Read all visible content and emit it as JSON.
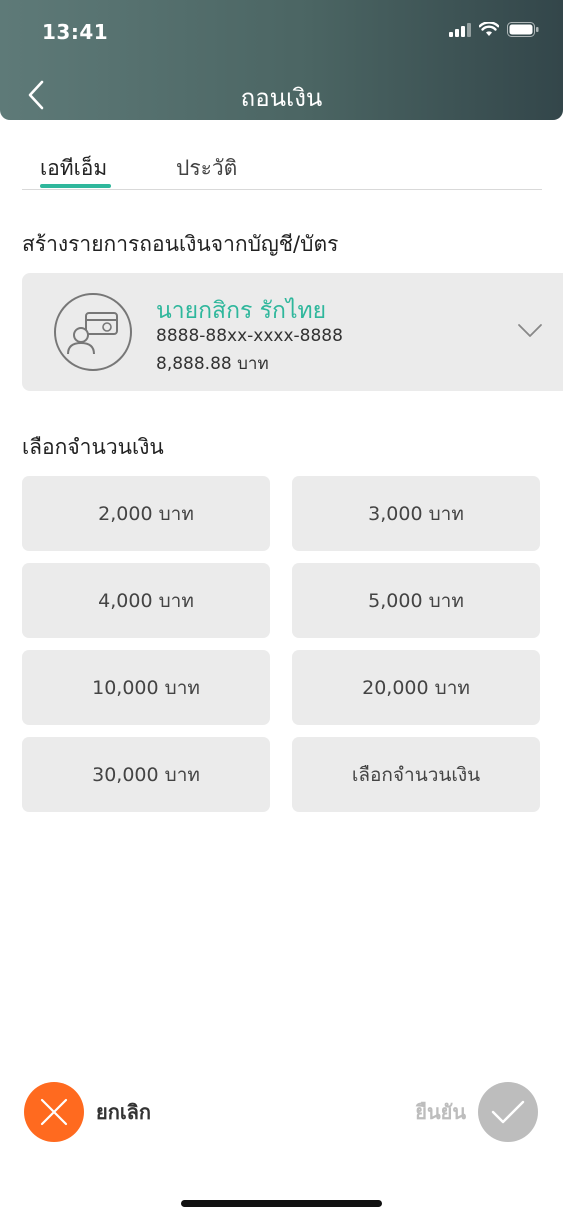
{
  "status_bar": {
    "time": "13:41"
  },
  "header": {
    "title": "ถอนเงิน"
  },
  "tabs": [
    {
      "label": "เอทีเอ็ม",
      "active": true
    },
    {
      "label": "ประวัติ",
      "active": false
    }
  ],
  "account_section": {
    "title": "สร้างรายการถอนเงินจากบัญชี/บัตร",
    "account": {
      "name": "นายกสิกร รักไทย",
      "number": "8888-88xx-xxxx-8888",
      "balance": "8,888.88 บาท"
    }
  },
  "amount_section": {
    "title": "เลือกจำนวนเงิน",
    "options": [
      "2,000 บาท",
      "3,000 บาท",
      "4,000 บาท",
      "5,000 บาท",
      "10,000 บาท",
      "20,000 บาท",
      "30,000 บาท",
      "เลือกจำนวนเงิน"
    ]
  },
  "actions": {
    "cancel_label": "ยกเลิก",
    "confirm_label": "ยืนยัน"
  },
  "colors": {
    "accent": "#2fb79c",
    "cancel": "#ff6a1f",
    "disabled": "#bdbdbd",
    "header": "#4b6563"
  }
}
